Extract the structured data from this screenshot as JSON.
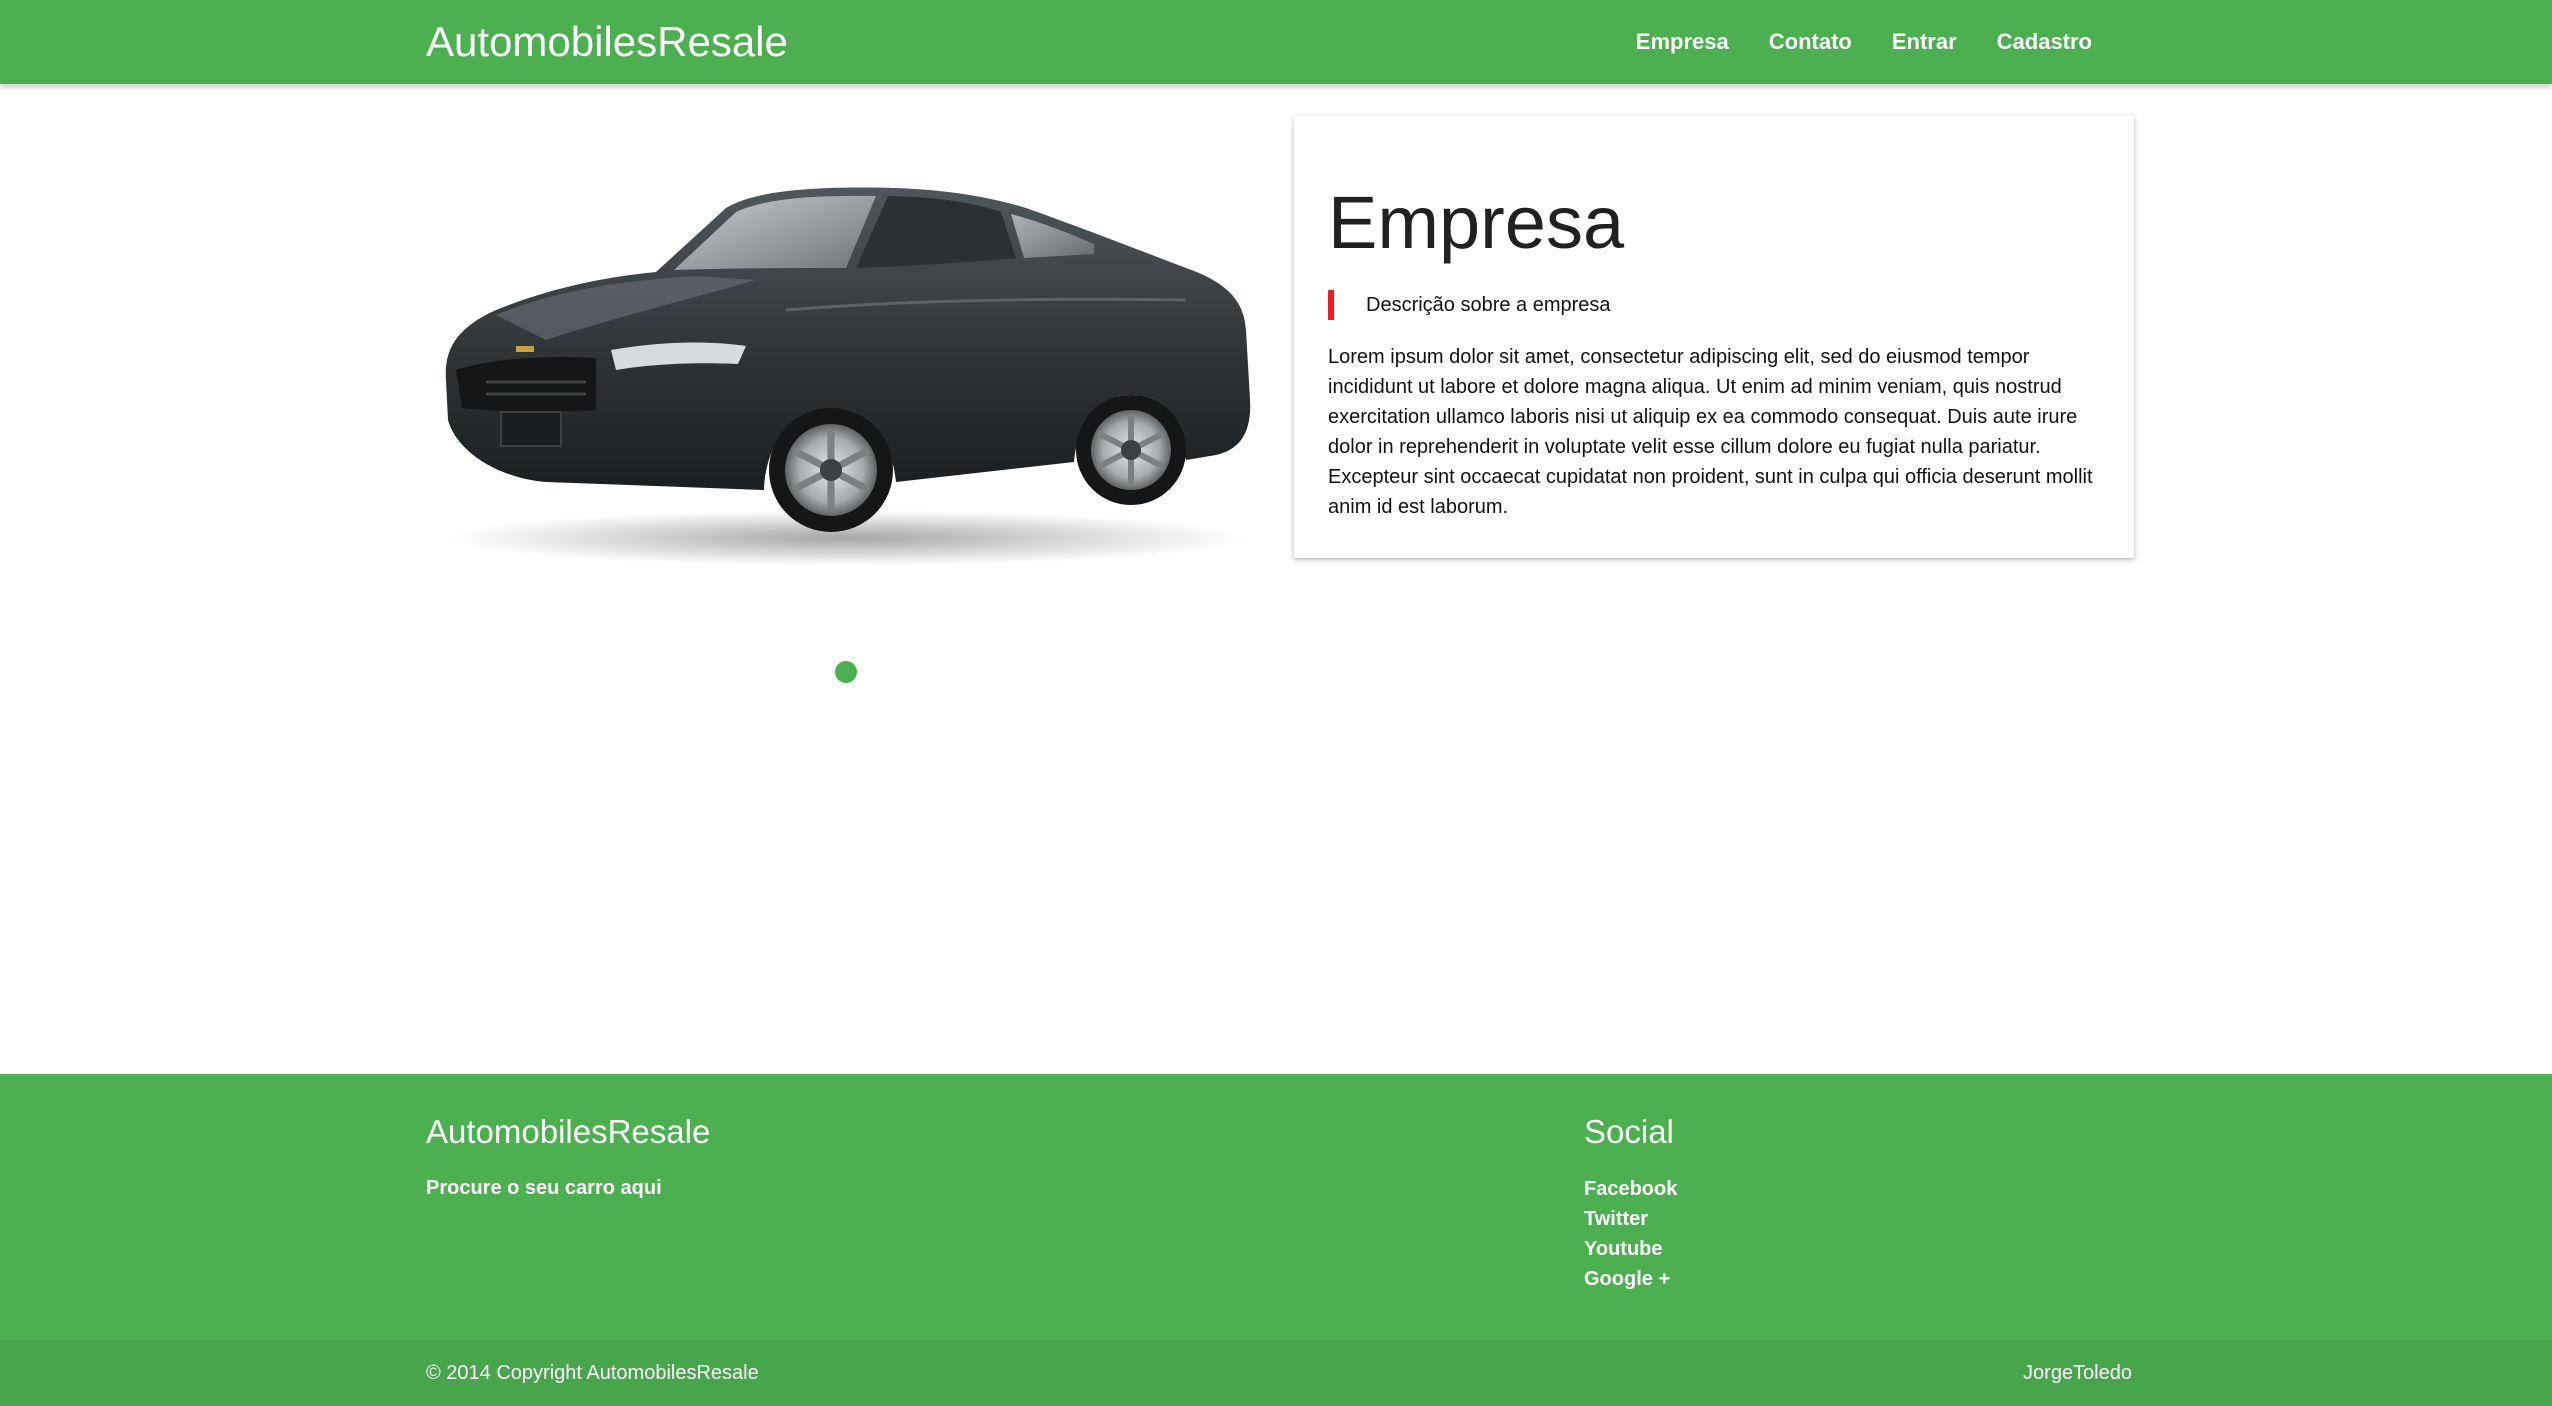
{
  "header": {
    "brand": "AutomobilesResale",
    "nav": [
      "Empresa",
      "Contato",
      "Entrar",
      "Cadastro"
    ]
  },
  "hero": {
    "image": "car-photo",
    "slider_active_index": 1
  },
  "card": {
    "title": "Empresa",
    "quote": "Descrição sobre a empresa",
    "body": "Lorem ipsum dolor sit amet, consectetur adipiscing elit, sed do eiusmod tempor incididunt ut labore et dolore magna aliqua. Ut enim ad minim veniam, quis nostrud exercitation ullamco laboris nisi ut aliquip ex ea commodo consequat. Duis aute irure dolor in reprehenderit in voluptate velit esse cillum dolore eu fugiat nulla pariatur. Excepteur sint occaecat cupidatat non proident, sunt in culpa qui officia deserunt mollit anim id est laborum."
  },
  "footer": {
    "brand": "AutomobilesResale",
    "tagline": "Procure o seu carro aqui",
    "social_title": "Social",
    "social_links": [
      "Facebook",
      "Twitter",
      "Youtube",
      "Google +"
    ]
  },
  "copyright": {
    "text": "© 2014 Copyright AutomobilesResale",
    "author": "JorgeToledo"
  },
  "colors": {
    "primary": "#4caf50",
    "footer_bottom": "#47a54b",
    "quote_accent": "#ee1c25",
    "car_body": "#2f3437"
  }
}
